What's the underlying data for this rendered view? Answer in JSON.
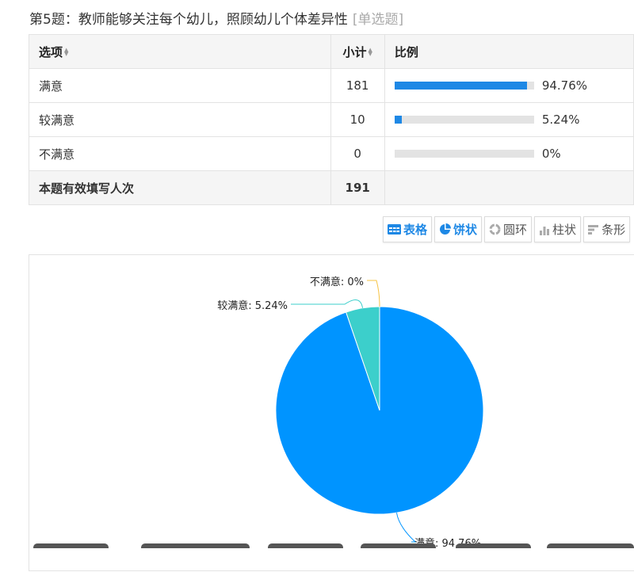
{
  "question": {
    "title": "第5题：教师能够关注每个幼儿，照顾幼儿个体差异性",
    "type": "[单选题]"
  },
  "table": {
    "headers": {
      "option": "选项",
      "count": "小计",
      "ratio": "比例"
    },
    "rows": [
      {
        "option": "满意",
        "count": "181",
        "percent_text": "94.76%",
        "percent": 94.76
      },
      {
        "option": "较满意",
        "count": "10",
        "percent_text": "5.24%",
        "percent": 5.24
      },
      {
        "option": "不满意",
        "count": "0",
        "percent_text": "0%",
        "percent": 0
      }
    ],
    "total_label": "本题有效填写人次",
    "total_count": "191"
  },
  "toolbar": {
    "buttons": [
      {
        "label": "表格",
        "icon": "table-icon",
        "active": true
      },
      {
        "label": "饼状",
        "icon": "pie-chart-icon",
        "active": true
      },
      {
        "label": "圆环",
        "icon": "donut-chart-icon",
        "active": false
      },
      {
        "label": "柱状",
        "icon": "bar-chart-icon",
        "active": false
      },
      {
        "label": "条形",
        "icon": "horizontal-bar-icon",
        "active": false
      }
    ]
  },
  "colors": {
    "accent": "#1e88e5",
    "bar_track": "#e3e3e3",
    "pie_main": "#0094ff",
    "pie_second": "#3ccfcb",
    "pie_third": "#f6c343"
  },
  "chart_data": {
    "type": "pie",
    "categories": [
      "满意",
      "较满意",
      "不满意"
    ],
    "values": [
      94.76,
      5.24,
      0
    ],
    "labels": [
      "满意: 94.76%",
      "较满意: 5.24%",
      "不满意: 0%"
    ],
    "colors": [
      "#0094ff",
      "#3ccfcb",
      "#f6c343"
    ],
    "legend": "none"
  }
}
